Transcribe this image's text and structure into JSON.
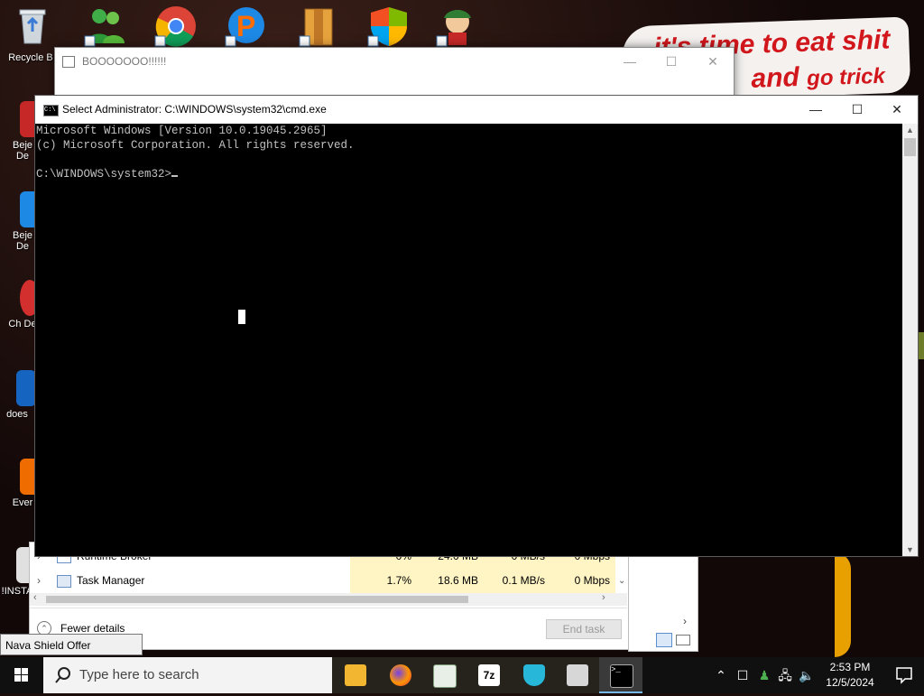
{
  "desktop": {
    "icons": [
      {
        "label": "Recycle B"
      },
      {
        "label": "Beje De"
      },
      {
        "label": "Beje De"
      },
      {
        "label": "Ch De"
      },
      {
        "label": "does"
      },
      {
        "label": "Ever"
      },
      {
        "label": "!INSTA"
      }
    ],
    "banner": {
      "line1": "it's time to eat shit",
      "line2_a": "and",
      "line2_b": "go trick"
    }
  },
  "bg_window": {
    "title": "BOOOOOOO!!!!!!",
    "minimize": "—",
    "maximize": "☐",
    "close": "✕"
  },
  "task_manager": {
    "rows": [
      {
        "name": "Runtime Broker",
        "cpu": "0%",
        "memory": "24.0 MB",
        "disk": "0 MB/s",
        "network": "0 Mbps"
      },
      {
        "name": "Task Manager",
        "cpu": "1.7%",
        "memory": "18.6 MB",
        "disk": "0.1 MB/s",
        "network": "0 Mbps"
      }
    ],
    "fewer_details": "Fewer details",
    "end_task": "End task"
  },
  "cmd": {
    "title": "Select Administrator: C:\\WINDOWS\\system32\\cmd.exe",
    "line1": "Microsoft Windows [Version 10.0.19045.2965]",
    "line2": "(c) Microsoft Corporation. All rights reserved.",
    "prompt": "C:\\WINDOWS\\system32>",
    "minimize": "—",
    "maximize": "☐",
    "close": "✕"
  },
  "tooltip": "Nava Shield Offer",
  "taskbar": {
    "search_placeholder": "Type here to search",
    "time": "2:53 PM",
    "date": "12/5/2024"
  },
  "colors": {
    "accent": "#0078d7",
    "banner_text": "#d2171c",
    "cmd_bg": "#000000",
    "cmd_text": "#c0c0c0",
    "taskbar": "#101010",
    "highlight": "#fff4c4"
  }
}
